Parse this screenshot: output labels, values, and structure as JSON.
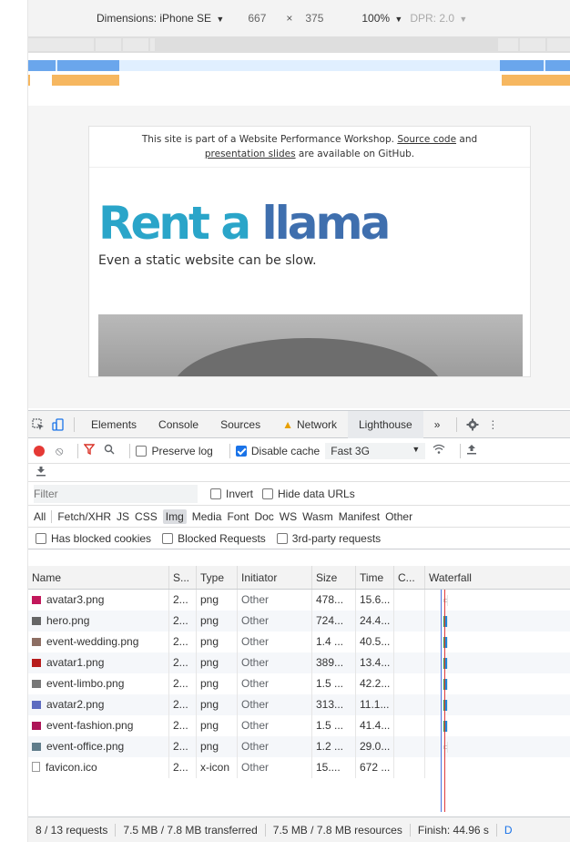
{
  "device_toolbar": {
    "dimensions_label": "Dimensions: iPhone SE",
    "width": "667",
    "times": "×",
    "height": "375",
    "zoom": "100%",
    "dpr": "DPR: 2.0"
  },
  "page": {
    "banner_text_1": "This site is part of a Website Performance Workshop.",
    "banner_link_1": "Source code",
    "banner_text_2": "and",
    "banner_link_2": "presentation slides",
    "banner_text_3": "are available on GitHub.",
    "title_part1": "Rent a ",
    "title_part2": "llama",
    "subtitle": "Even a static website can be slow."
  },
  "devtools_tabs": {
    "elements": "Elements",
    "console": "Console",
    "sources": "Sources",
    "network": "Network",
    "lighthouse": "Lighthouse",
    "more": "»"
  },
  "network_toolbar": {
    "preserve_log": "Preserve log",
    "disable_cache": "Disable cache",
    "throttle": "Fast 3G"
  },
  "filter": {
    "placeholder": "Filter",
    "invert": "Invert",
    "hide_data_urls": "Hide data URLs"
  },
  "types": [
    "All",
    "Fetch/XHR",
    "JS",
    "CSS",
    "Img",
    "Media",
    "Font",
    "Doc",
    "WS",
    "Wasm",
    "Manifest",
    "Other"
  ],
  "blocked": {
    "has_blocked_cookies": "Has blocked cookies",
    "blocked_requests": "Blocked Requests",
    "third_party": "3rd-party requests"
  },
  "columns": {
    "name": "Name",
    "status": "S...",
    "type": "Type",
    "initiator": "Initiator",
    "size": "Size",
    "time": "Time",
    "c": "C...",
    "waterfall": "Waterfall"
  },
  "rows": [
    {
      "name": "avatar3.png",
      "status": "2...",
      "type": "png",
      "initiator": "Other",
      "size": "478...",
      "time": "15.6...",
      "icon_color": "#c2185b",
      "queue": 0.39,
      "wait": 0.0,
      "dl": 0.34
    },
    {
      "name": "hero.png",
      "status": "2...",
      "type": "png",
      "initiator": "Other",
      "size": "724...",
      "time": "24.4...",
      "icon_color": "#666666",
      "queue": 0.0,
      "wait": 0.0,
      "dl": 0.54
    },
    {
      "name": "event-wedding.png",
      "status": "2...",
      "type": "png",
      "initiator": "Other",
      "size": "1.4 ...",
      "time": "40.5...",
      "icon_color": "#8d6e63",
      "queue": 0.0,
      "wait": 0.0,
      "dl": 0.88
    },
    {
      "name": "avatar1.png",
      "status": "2...",
      "type": "png",
      "initiator": "Other",
      "size": "389...",
      "time": "13.4...",
      "icon_color": "#b71c1c",
      "queue": 0.0,
      "wait": 0.0,
      "dl": 0.3
    },
    {
      "name": "event-limbo.png",
      "status": "2...",
      "type": "png",
      "initiator": "Other",
      "size": "1.5 ...",
      "time": "42.2...",
      "icon_color": "#777777",
      "queue": 0.0,
      "wait": 0.0,
      "dl": 0.88
    },
    {
      "name": "avatar2.png",
      "status": "2...",
      "type": "png",
      "initiator": "Other",
      "size": "313...",
      "time": "11.1...",
      "icon_color": "#5c6bc0",
      "queue": 0.0,
      "wait": 0.0,
      "dl": 0.25
    },
    {
      "name": "event-fashion.png",
      "status": "2...",
      "type": "png",
      "initiator": "Other",
      "size": "1.5 ...",
      "time": "41.4...",
      "icon_color": "#ad1457",
      "queue": 0.0,
      "wait": 0.0,
      "dl": 0.88
    },
    {
      "name": "event-office.png",
      "status": "2...",
      "type": "png",
      "initiator": "Other",
      "size": "1.2 ...",
      "time": "29.0...",
      "icon_color": "#607d8b",
      "queue": 0.28,
      "wait": 0.0,
      "dl": 0.6
    },
    {
      "name": "favicon.ico",
      "status": "2...",
      "type": "x-icon",
      "initiator": "Other",
      "size": "15....",
      "time": "672 ...",
      "icon_color": "#ffffff",
      "queue": 0.0,
      "wait": 0.0,
      "dl": 0.0
    }
  ],
  "status_bar": {
    "requests": "8 / 13 requests",
    "transferred": "7.5 MB / 7.8 MB transferred",
    "resources": "7.5 MB / 7.8 MB resources",
    "finish": "Finish: 44.96 s",
    "dom": "D"
  }
}
